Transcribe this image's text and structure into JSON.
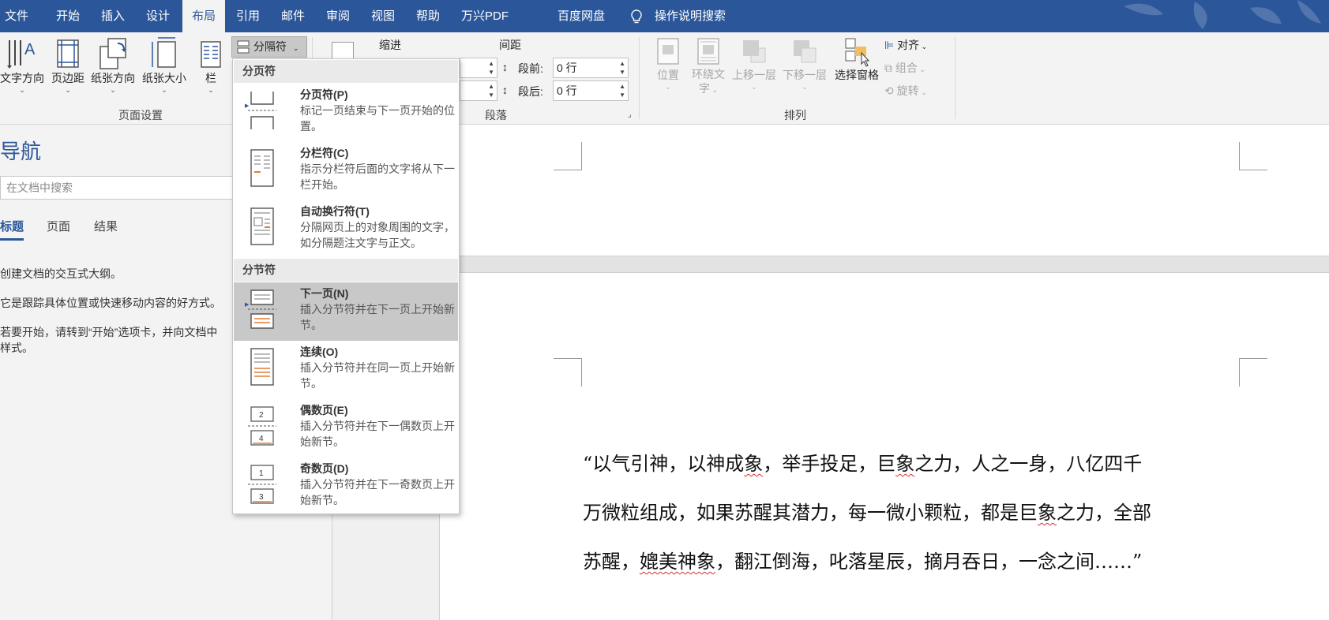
{
  "menu": {
    "tabs": [
      "文件",
      "开始",
      "插入",
      "设计",
      "布局",
      "引用",
      "邮件",
      "审阅",
      "视图",
      "帮助",
      "万兴PDF",
      "百度网盘"
    ],
    "active_tab": "布局",
    "tell_me": "操作说明搜索"
  },
  "ribbon": {
    "page_setup": {
      "text_direction": "文字方向",
      "margins": "页边距",
      "orientation": "纸张方向",
      "size": "纸张大小",
      "columns": "栏",
      "breaks": "分隔符",
      "group_label": "页面设置"
    },
    "paragraph": {
      "indent_label": "缩进",
      "spacing_label": "间距",
      "before_label": "段前:",
      "before_value": "0 行",
      "after_label": "段后:",
      "after_value": "0 行",
      "group_label": "段落"
    },
    "arrange": {
      "position": "位置",
      "wrap_text_1": "环绕文",
      "wrap_text_2": "字",
      "bring_forward": "上移一层",
      "send_backward": "下移一层",
      "selection_pane": "选择窗格",
      "align": "对齐",
      "group": "组合",
      "rotate": "旋转",
      "group_label": "排列"
    }
  },
  "breaks_menu": {
    "page_breaks_header": "分页符",
    "section_breaks_header": "分节符",
    "items": [
      {
        "title": "分页符(P)",
        "desc": "标记一页结束与下一页开始的位置。"
      },
      {
        "title": "分栏符(C)",
        "desc": "指示分栏符后面的文字将从下一栏开始。"
      },
      {
        "title": "自动换行符(T)",
        "desc": "分隔网页上的对象周围的文字，如分隔题注文字与正文。"
      },
      {
        "title": "下一页(N)",
        "desc": "插入分节符并在下一页上开始新节。"
      },
      {
        "title": "连续(O)",
        "desc": "插入分节符并在同一页上开始新节。"
      },
      {
        "title": "偶数页(E)",
        "desc": "插入分节符并在下一偶数页上开始新节。"
      },
      {
        "title": "奇数页(D)",
        "desc": "插入分节符并在下一奇数页上开始新节。"
      }
    ]
  },
  "nav": {
    "title": "导航",
    "search_placeholder": "在文档中搜索",
    "tabs": [
      "标题",
      "页面",
      "结果"
    ],
    "p1": "创建文档的交互式大纲。",
    "p2": "它是跟踪具体位置或快速移动内容的好方式。",
    "p3a": "若要开始，请转到“开始”选项卡，并向文档中",
    "p3b": "样式。"
  },
  "document": {
    "line1a": "“以气引神，以神成",
    "line1b": "象",
    "line1c": "，举手投足，巨",
    "line1d": "象",
    "line1e": "之力，人之一身，八亿四千",
    "line2a": "万微粒组成，如果苏醒其潜力，每一微小颗粒，都是巨",
    "line2b": "象",
    "line2c": "之力，全部",
    "line3a": "苏醒，",
    "line3b": "媲美神象",
    "line3c": "，翻江倒海，叱落星辰，摘月吞日，一念之间……”"
  },
  "colors": {
    "accent": "#2b579a",
    "ribbon_bg": "#f3f3f3",
    "highlight": "#c8c8c8",
    "orange": "#e07b39"
  }
}
